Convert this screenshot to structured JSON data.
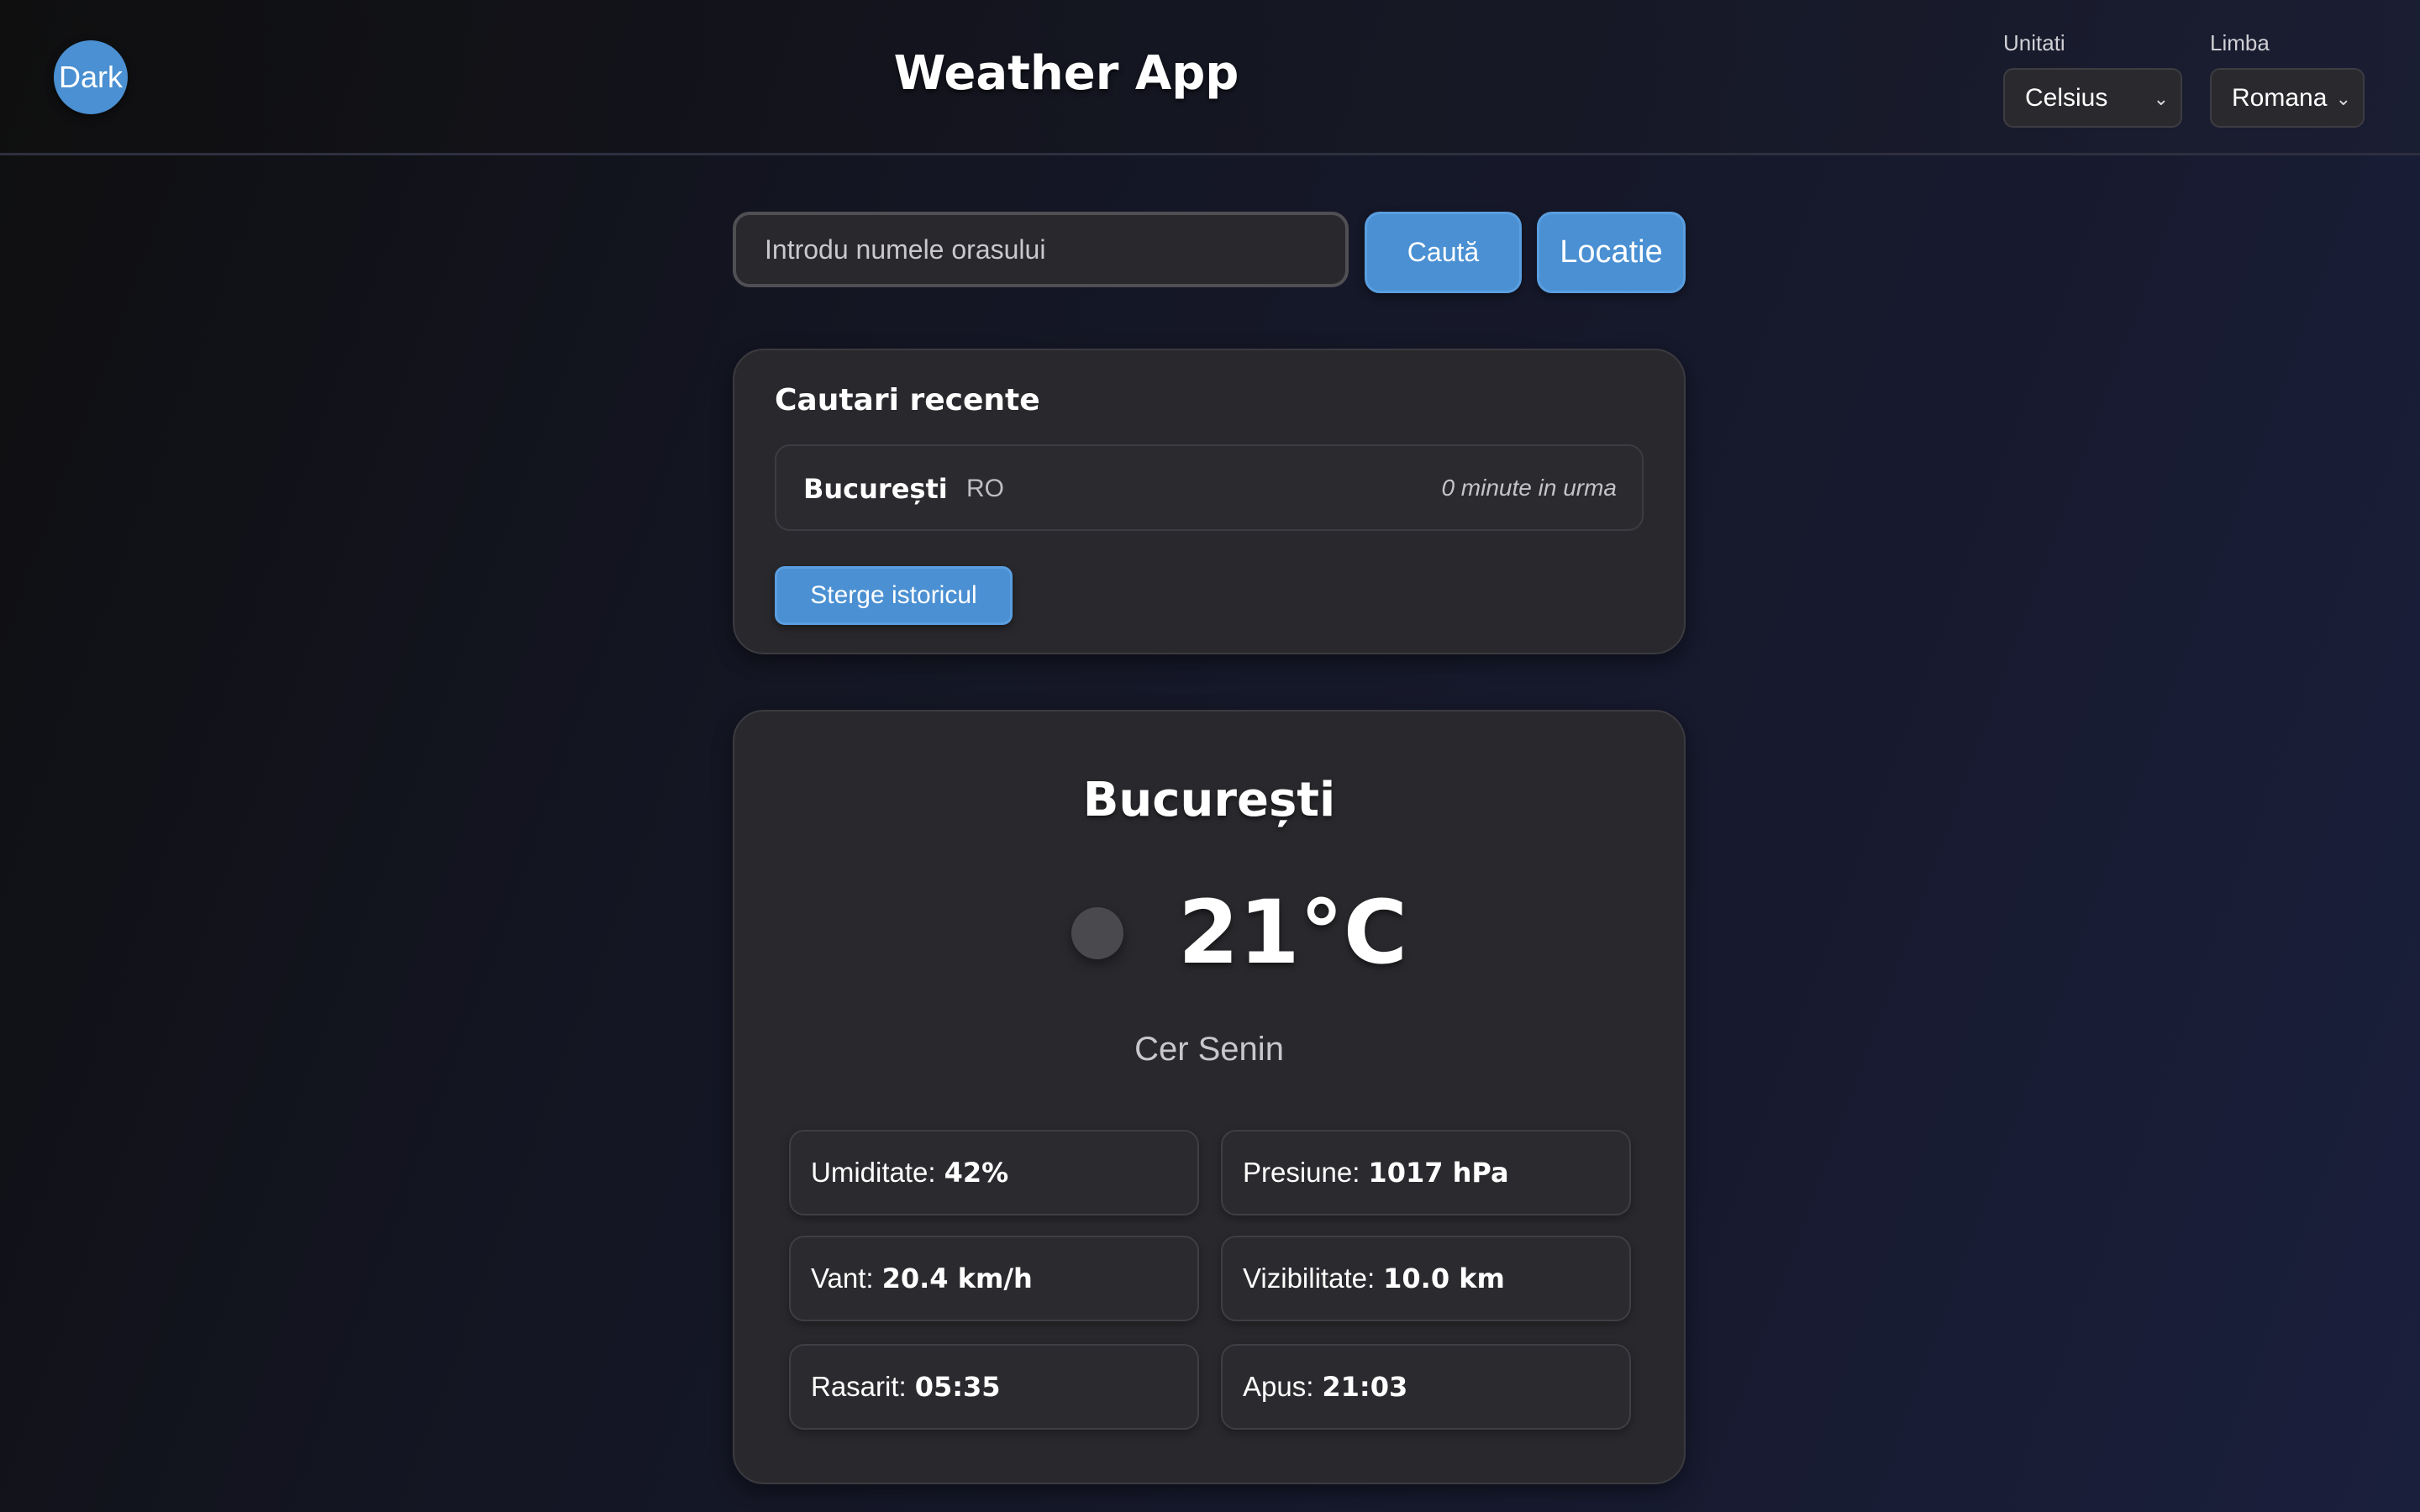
{
  "header": {
    "theme_toggle": "Dark",
    "title": "Weather App",
    "units_label": "Unitati",
    "units_value": "Celsius",
    "language_label": "Limba",
    "language_value": "Romana"
  },
  "search": {
    "placeholder": "Introdu numele orasului",
    "search_button": "Caută",
    "location_button": "Locatie"
  },
  "recent": {
    "title": "Cautari recente",
    "items": [
      {
        "city": "București",
        "country": "RO",
        "time": "0 minute in urma"
      }
    ],
    "clear_button": "Sterge istoricul"
  },
  "weather": {
    "city": "București",
    "temperature": "21°C",
    "description": "Cer Senin",
    "details": [
      {
        "label": "Umiditate:",
        "value": "42%"
      },
      {
        "label": "Presiune:",
        "value": "1017 hPa"
      },
      {
        "label": "Vant:",
        "value": "20.4 km/h"
      },
      {
        "label": "Vizibilitate:",
        "value": "10.0 km"
      },
      {
        "label": "Rasarit:",
        "value": "05:35"
      },
      {
        "label": "Apus:",
        "value": "21:03"
      }
    ]
  },
  "colors": {
    "accent": "#4a90d2",
    "card": "#29292d"
  }
}
